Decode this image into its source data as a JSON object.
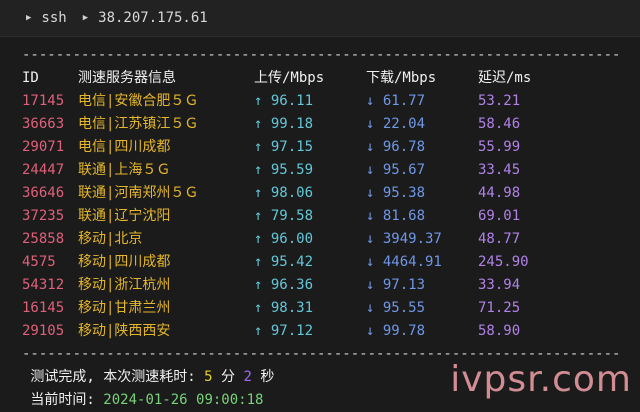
{
  "titlebar": {
    "command": "ssh",
    "host": "38.207.175.61"
  },
  "separator": "------------------------------------------------------------------------",
  "header": {
    "id": "ID",
    "service": "测速服务器信息",
    "upload": "上传/Mbps",
    "download": "下载/Mbps",
    "latency": "延迟/ms"
  },
  "rows": [
    {
      "id": "17145",
      "service": "电信|安徽合肥５Ｇ",
      "up": "↑ 96.11",
      "down": "↓ 61.77",
      "latency": "53.21"
    },
    {
      "id": "36663",
      "service": "电信|江苏镇江５Ｇ",
      "up": "↑ 99.18",
      "down": "↓ 22.04",
      "latency": "58.46"
    },
    {
      "id": "29071",
      "service": "电信|四川成都",
      "up": "↑ 97.15",
      "down": "↓ 96.78",
      "latency": "55.99"
    },
    {
      "id": "24447",
      "service": "联通|上海５Ｇ",
      "up": "↑ 95.59",
      "down": "↓ 95.67",
      "latency": "33.45"
    },
    {
      "id": "36646",
      "service": "联通|河南郑州５Ｇ",
      "up": "↑ 98.06",
      "down": "↓ 95.38",
      "latency": "44.98"
    },
    {
      "id": "37235",
      "service": "联通|辽宁沈阳",
      "up": "↑ 79.58",
      "down": "↓ 81.68",
      "latency": "69.01"
    },
    {
      "id": "25858",
      "service": "移动|北京",
      "up": "↑ 96.00",
      "down": "↓ 3949.37",
      "latency": "48.77"
    },
    {
      "id": "4575",
      "service": "移动|四川成都",
      "up": "↑ 95.42",
      "down": "↓ 4464.91",
      "latency": "245.90"
    },
    {
      "id": "54312",
      "service": "移动|浙江杭州",
      "up": "↑ 96.36",
      "down": "↓ 97.13",
      "latency": "33.94"
    },
    {
      "id": "16145",
      "service": "移动|甘肃兰州",
      "up": "↑ 98.31",
      "down": "↓ 95.55",
      "latency": "71.25"
    },
    {
      "id": "29105",
      "service": "移动|陕西西安",
      "up": "↑ 97.12",
      "down": "↓ 99.78",
      "latency": "58.90"
    }
  ],
  "summary": {
    "done_prefix": " 测试完成, 本次测速耗时: ",
    "minutes": "5",
    "min_unit": " 分 ",
    "seconds": "2",
    "sec_unit": " 秒",
    "time_prefix": " 当前时间: ",
    "time_value": "2024-01-26 09:00:18"
  },
  "watermark": "ivpsr.com",
  "icons": {
    "titlebar_arrow": "play-triangle-icon"
  },
  "colors": {
    "id": "#e0607a",
    "service": "#e4b62a",
    "upload": "#63c7d8",
    "download": "#6f97e6",
    "latency": "#b082e8"
  }
}
